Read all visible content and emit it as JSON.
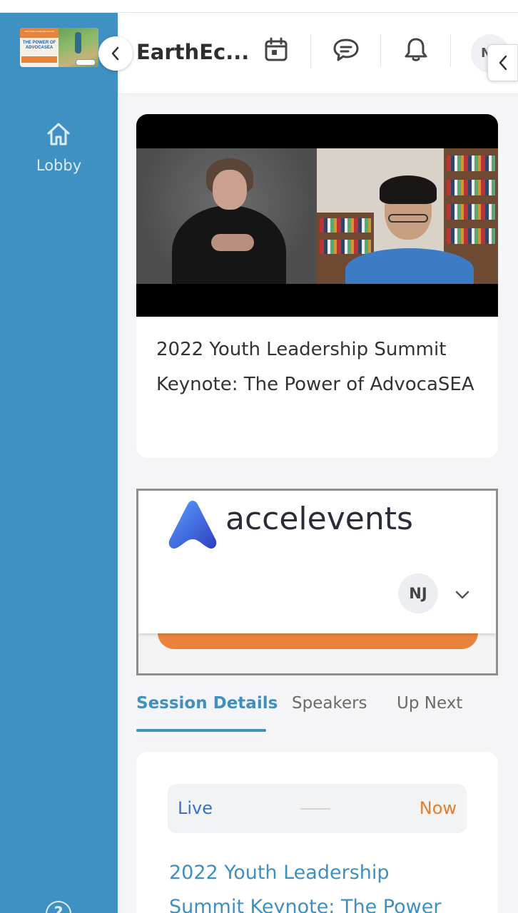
{
  "sidebar": {
    "thumbnail": {
      "line1": "2022 Youth Leadership Summit",
      "line2": "THE POWER OF ADVOCASEA"
    },
    "nav": [
      {
        "label": "Lobby",
        "icon": "home-icon"
      }
    ],
    "help_icon": "help-icon",
    "color": "#3f90c3"
  },
  "header": {
    "event_title": "EarthEc...",
    "icons": [
      "calendar-icon",
      "chat-icon",
      "bell-icon"
    ],
    "avatar_initial": "N"
  },
  "video": {
    "title": "2022 Youth Leadership Summit Keynote: The Power of AdvocaSEA"
  },
  "embed": {
    "brand": "accelevents",
    "user_initials": "NJ"
  },
  "tabs": [
    {
      "label": "Session Details",
      "active": true
    },
    {
      "label": "Speakers",
      "active": false
    },
    {
      "label": "Up Next",
      "active": false
    }
  ],
  "details": {
    "status_left": "Live",
    "status_right": "Now",
    "title": "2022 Youth Leadership Summit Keynote: The Power"
  },
  "colors": {
    "accent": "#3f8fbf",
    "live": "#3b6fc4",
    "now": "#e57d2f",
    "orange": "#e9833c"
  }
}
